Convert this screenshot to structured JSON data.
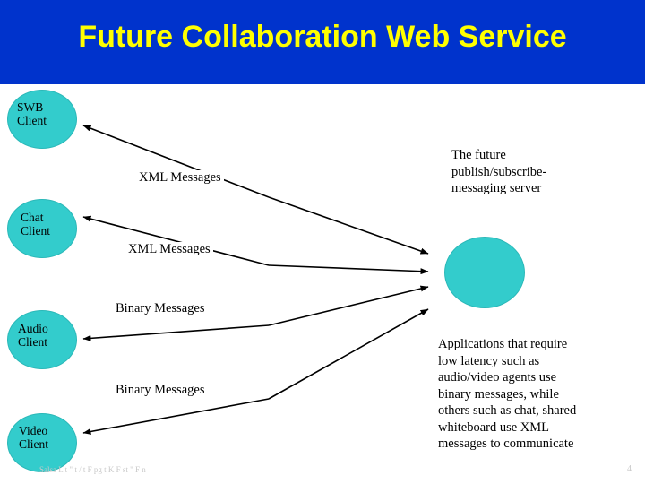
{
  "slide": {
    "title": "Future Collaboration Web Service",
    "title_color": "#ffff00",
    "band_color": "#0033cc",
    "node_color": "#33cccc",
    "page_number": "4",
    "footer": "Salsa  L            t \"    t /  t F      pg t K     F       st  \"  F  n"
  },
  "nodes": [
    {
      "label": "SWB\nClient"
    },
    {
      "label": "Chat\nClient"
    },
    {
      "label": "Audio\nClient"
    },
    {
      "label": "Video\nClient"
    },
    {
      "label": ""
    }
  ],
  "message_labels": [
    {
      "text": "XML Messages"
    },
    {
      "text": "XML Messages"
    },
    {
      "text": "Binary Messages"
    },
    {
      "text": "Binary Messages"
    }
  ],
  "annotations": {
    "server": "The future\npublish/subscribe-\nmessaging server",
    "description": "Applications that require\nlow latency such as\naudio/video agents use\nbinary messages, while\nothers such as chat, shared\nwhiteboard use XML\nmessages to communicate"
  }
}
